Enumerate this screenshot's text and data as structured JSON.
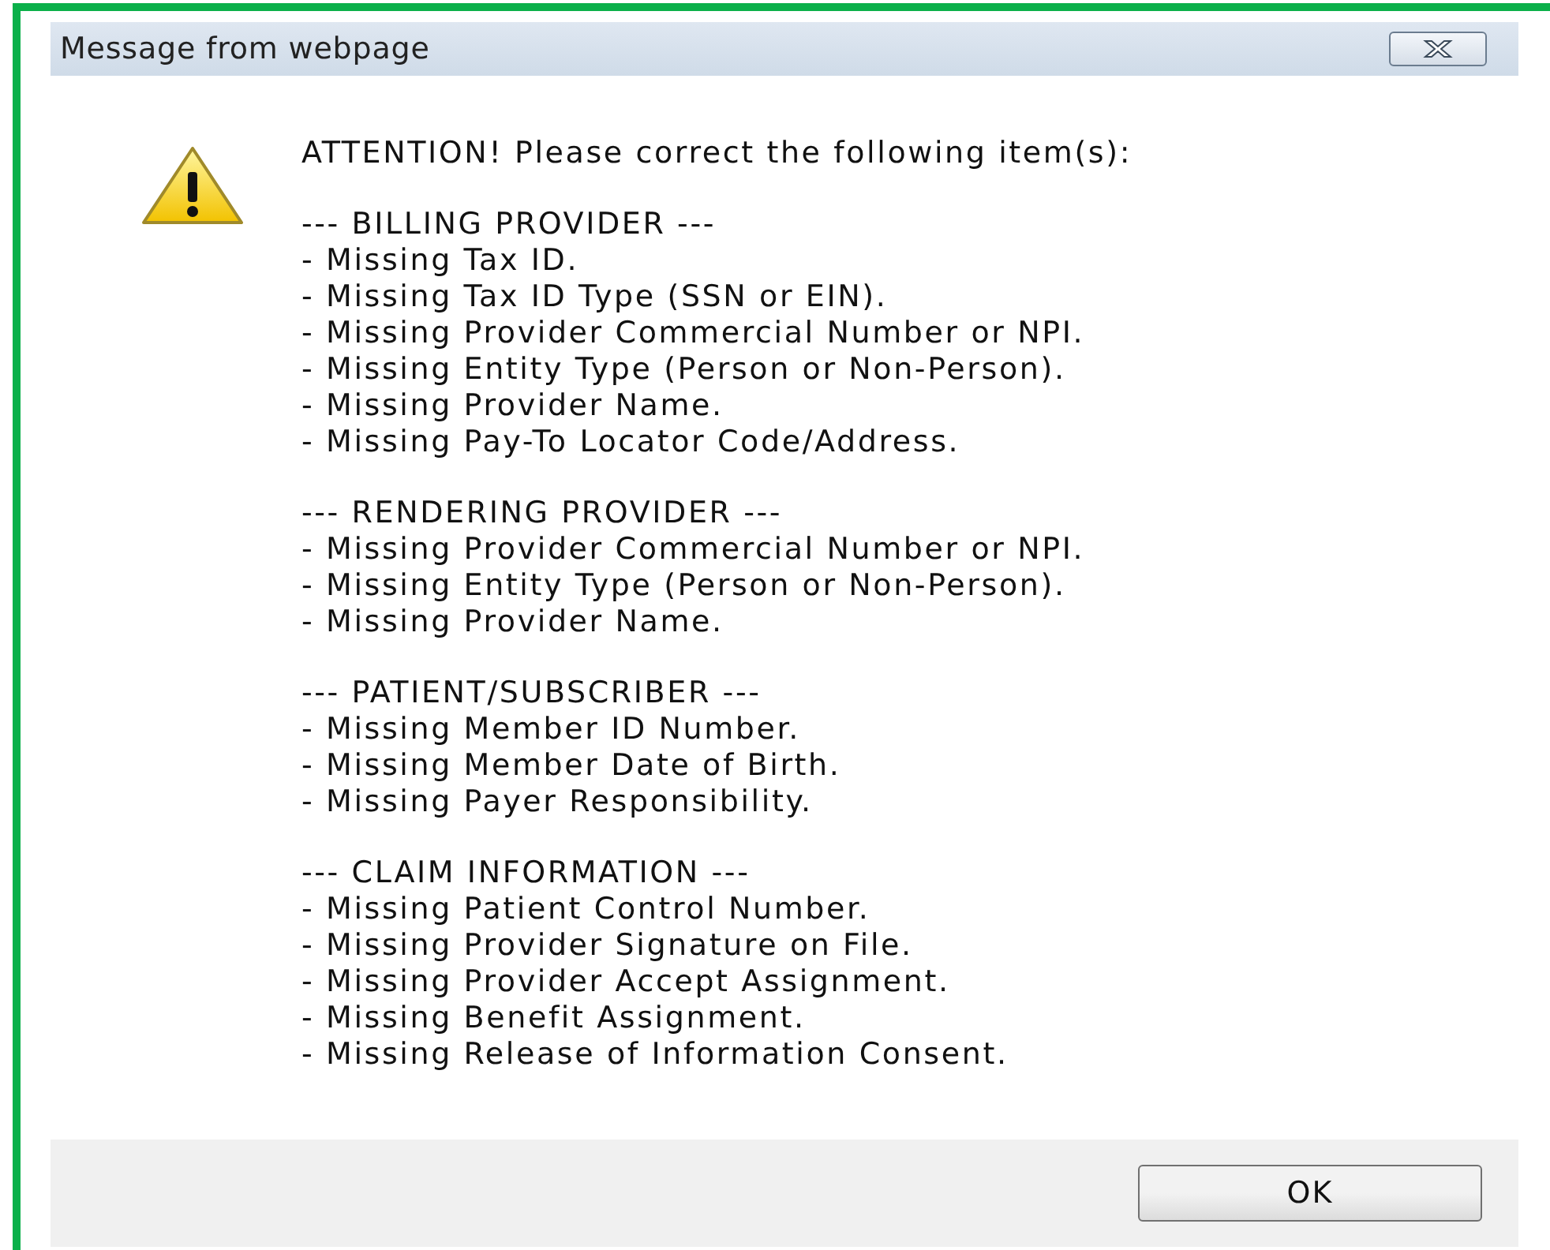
{
  "window": {
    "title": "Message from webpage"
  },
  "message": {
    "heading": "ATTENTION!  Please correct the following item(s):",
    "sections": [
      {
        "title": "--- BILLING PROVIDER ---",
        "items": [
          "- Missing Tax ID.",
          "- Missing Tax ID Type (SSN or EIN).",
          "- Missing Provider Commercial Number or NPI.",
          "- Missing Entity Type (Person or Non-Person).",
          "- Missing Provider Name.",
          "- Missing Pay-To Locator Code/Address."
        ]
      },
      {
        "title": "--- RENDERING PROVIDER ---",
        "items": [
          "- Missing Provider Commercial Number or NPI.",
          "- Missing Entity Type (Person or Non-Person).",
          "- Missing Provider Name."
        ]
      },
      {
        "title": "--- PATIENT/SUBSCRIBER ---",
        "items": [
          "- Missing Member ID Number.",
          "- Missing Member Date of Birth.",
          "- Missing Payer Responsibility."
        ]
      },
      {
        "title": "--- CLAIM INFORMATION ---",
        "items": [
          "- Missing Patient Control Number.",
          "- Missing Provider Signature on File.",
          "- Missing Provider Accept Assignment.",
          "- Missing Benefit Assignment.",
          "- Missing Release of Information Consent."
        ]
      }
    ]
  },
  "buttons": [
    "OK"
  ]
}
